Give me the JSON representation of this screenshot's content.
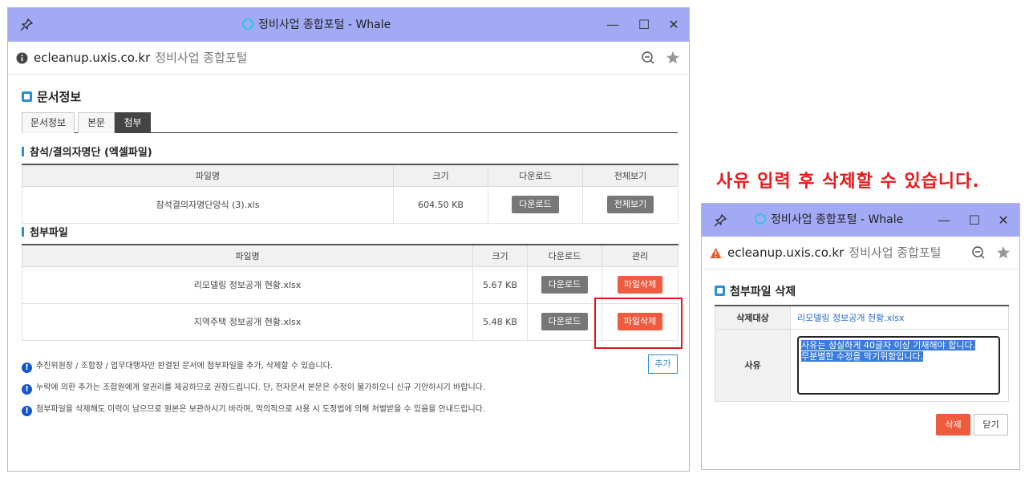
{
  "main_window": {
    "title": "정비사업 종합포털 - Whale",
    "address": {
      "url": "ecleanup.uxis.co.kr",
      "site_name": "정비사업 종합포털"
    },
    "section_title": "문서정보",
    "tabs": [
      {
        "label": "문서정보",
        "active": false
      },
      {
        "label": "본문",
        "active": false
      },
      {
        "label": "첨부",
        "active": true
      }
    ],
    "attendance": {
      "title": "참석/결의자명단 (엑셀파일)",
      "headers": [
        "파일명",
        "크기",
        "다운로드",
        "전체보기"
      ],
      "row": {
        "file": "참석결의자명단양식 (3).xls",
        "size": "604.50 KB",
        "download": "다운로드",
        "view": "전체보기"
      }
    },
    "attachments": {
      "title": "첨부파일",
      "headers": [
        "파일명",
        "크기",
        "다운로드",
        "관리"
      ],
      "rows": [
        {
          "file": "리모델링 정보공개 현황.xlsx",
          "size": "5.67 KB",
          "download": "다운로드",
          "action": "파일삭제"
        },
        {
          "file": "지역주택 정보공개 현황.xlsx",
          "size": "5.48 KB",
          "download": "다운로드",
          "action": "파일삭제"
        }
      ]
    },
    "notes": [
      "추진위원장 / 조합장 / 업무대행자만 완결된 문서에 첨부파일을 추가, 삭제할 수 있습니다.",
      "누락에 의한 추가는 조합원에게 알권리를 제공하므로 권장드립니다. 단, 전자문서 본문은 수정이 불가하오니 신규 기안하시기 바랍니다.",
      "첨부파일을 삭제해도 이력이 남으므로 원본은 보관하시기 바라며, 악의적으로 사용 시 도정법에 의해 처벌받을 수 있음을 안내드립니다."
    ],
    "add_button": "추가"
  },
  "headline": "사유 입력 후 삭제할 수 있습니다.",
  "popup_window": {
    "title": "정비사업 종합포털 - Whale",
    "address": {
      "url": "ecleanup.uxis.co.kr",
      "site_name": "정비사업 종합포털"
    },
    "section_title": "첨부파일 삭제",
    "target_label": "삭제대상",
    "target_value": "리모델링 정보공개 현황.xlsx",
    "reason_label": "사유",
    "reason_line1": "사유는 성실하게 40글자 이상 기재해야 합니다.",
    "reason_line2": "무분별한 수정을 막기위함입니다.",
    "delete_button": "삭제",
    "close_button": "닫기"
  },
  "colors": {
    "titlebar": "#a2aaf6",
    "accent_blue": "#2a8fd4",
    "delete_red": "#ee5b3e",
    "highlight_red": "#e3161d"
  }
}
